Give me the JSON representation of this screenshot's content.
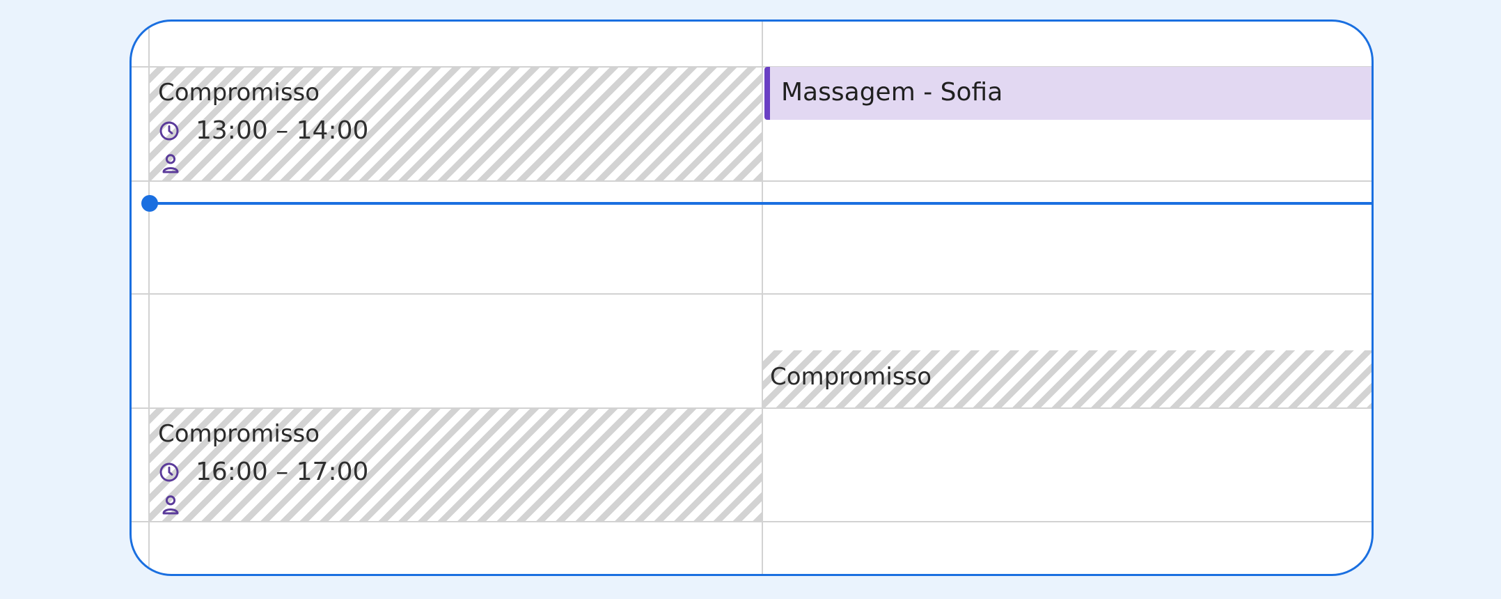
{
  "colors": {
    "frame_border": "#1a6fe0",
    "now_indicator": "#1a6fe0",
    "massage_bg": "#e2d8f2",
    "massage_accent": "#6a3fc4",
    "icon": "#5a3a9a",
    "grid": "#d2d2d2"
  },
  "events": {
    "appt1": {
      "title": "Compromisso",
      "time": "13:00 – 14:00",
      "icons": [
        "clock-icon",
        "person-icon"
      ]
    },
    "massage": {
      "title": "Massagem - Sofia"
    },
    "appt2": {
      "title": "Compromisso"
    },
    "appt3": {
      "title": "Compromisso",
      "time": "16:00 – 17:00",
      "icons": [
        "clock-icon",
        "person-icon"
      ]
    }
  }
}
